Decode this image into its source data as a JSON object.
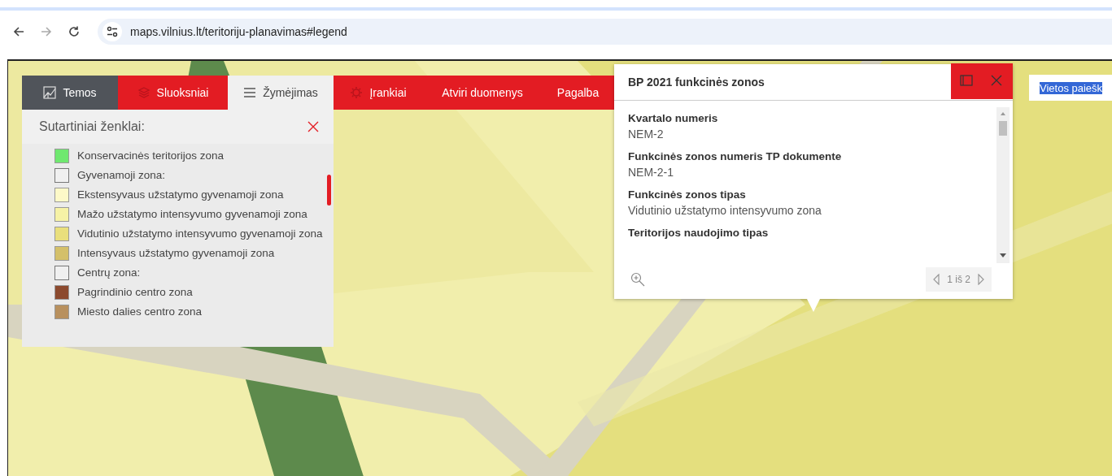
{
  "browser": {
    "url": "maps.vilnius.lt/teritoriju-planavimas#legend"
  },
  "tabs": [
    {
      "label": "Temos",
      "kind": "themes",
      "selected": false
    },
    {
      "label": "Sluoksniai",
      "kind": "layers",
      "selected": false
    },
    {
      "label": "Žymėjimas",
      "kind": "legend",
      "selected": true
    },
    {
      "label": "Įrankiai",
      "kind": "tools",
      "selected": false
    },
    {
      "label": "Atviri duomenys",
      "kind": "plain",
      "selected": false
    },
    {
      "label": "Pagalba",
      "kind": "plain",
      "selected": false
    }
  ],
  "legend": {
    "title": "Sutartiniai ženklai:",
    "items": [
      {
        "label": "Konservacinės teritorijos zona",
        "kind": "zone",
        "color": "#6fe86f"
      },
      {
        "label": "Gyvenamoji zona:",
        "kind": "group"
      },
      {
        "label": "Ekstensyvaus užstatymo gyvenamoji zona",
        "kind": "zone",
        "color": "#fdf9c8"
      },
      {
        "label": "Mažo užstatymo intensyvumo gyvenamoji zona",
        "kind": "zone",
        "color": "#f6f2a6"
      },
      {
        "label": "Vidutinio užstatymo intensyvumo gyvenamoji zona",
        "kind": "zone",
        "color": "#e9df7c"
      },
      {
        "label": "Intensyvaus užstatymo gyvenamoji zona",
        "kind": "zone",
        "color": "#d4c06a"
      },
      {
        "label": "Centrų zona:",
        "kind": "group"
      },
      {
        "label": "Pagrindinio centro zona",
        "kind": "zone",
        "color": "#8c4a2e"
      },
      {
        "label": "Miesto dalies centro zona",
        "kind": "zone",
        "color": "#b8905e"
      }
    ]
  },
  "popup": {
    "title": "BP 2021 funkcinės zonos",
    "fields": [
      {
        "label": "Kvartalo numeris",
        "value": "NEM-2"
      },
      {
        "label": "Funkcinės zonos numeris TP dokumente",
        "value": "NEM-2-1"
      },
      {
        "label": "Funkcinės zonos tipas",
        "value": "Vidutinio užstatymo intensyvumo zona"
      },
      {
        "label": "Teritorijos naudojimo tipas"
      }
    ],
    "pager": "1 iš 2"
  },
  "search": {
    "value": "Vietos paiešk",
    "highlighted": true
  }
}
